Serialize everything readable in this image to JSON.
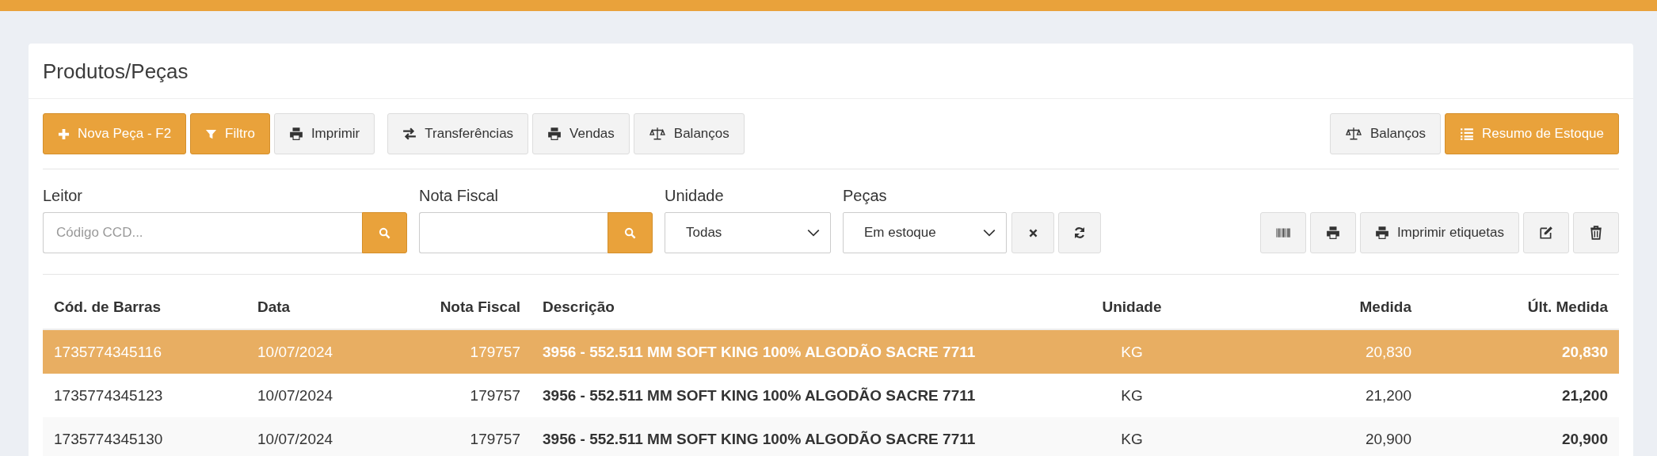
{
  "title": "Produtos/Peças",
  "toolbar_left": [
    {
      "label": "Nova Peça - F2",
      "kind": "primary"
    },
    {
      "label": "Filtro",
      "kind": "primary"
    },
    {
      "label": "Imprimir",
      "kind": "default"
    },
    {
      "label": "Transferências",
      "kind": "default"
    },
    {
      "label": "Vendas",
      "kind": "default"
    },
    {
      "label": "Balanços",
      "kind": "default"
    }
  ],
  "toolbar_right": [
    {
      "label": "Balanços",
      "kind": "default"
    },
    {
      "label": "Resumo de Estoque",
      "kind": "primary"
    }
  ],
  "filters": {
    "leitor": {
      "label": "Leitor",
      "placeholder": "Código CCD..."
    },
    "nota_fiscal": {
      "label": "Nota Fiscal"
    },
    "unidade": {
      "label": "Unidade",
      "value": "Todas"
    },
    "pecas": {
      "label": "Peças",
      "value": "Em estoque"
    }
  },
  "label_actions": [
    {
      "kind": "icon"
    },
    {
      "kind": "icon"
    },
    {
      "kind": "text",
      "label": "Imprimir etiquetas"
    },
    {
      "kind": "icon"
    },
    {
      "kind": "icon"
    }
  ],
  "table": {
    "columns": [
      "Cód. de Barras",
      "Data",
      "Nota Fiscal",
      "Descrição",
      "Unidade",
      "Medida",
      "Últ. Medida"
    ],
    "rows": [
      {
        "selected": true,
        "cells": [
          "1735774345116",
          "10/07/2024",
          "179757",
          "3956 - 552.511 MM SOFT KING 100% ALGODÃO SACRE 7711",
          "KG",
          "20,830",
          "20,830"
        ]
      },
      {
        "selected": false,
        "cells": [
          "1735774345123",
          "10/07/2024",
          "179757",
          "3956 - 552.511 MM SOFT KING 100% ALGODÃO SACRE 7711",
          "KG",
          "21,200",
          "21,200"
        ]
      },
      {
        "selected": false,
        "cells": [
          "1735774345130",
          "10/07/2024",
          "179757",
          "3956 - 552.511 MM SOFT KING 100% ALGODÃO SACRE 7711",
          "KG",
          "20,900",
          "20,900"
        ]
      }
    ]
  }
}
